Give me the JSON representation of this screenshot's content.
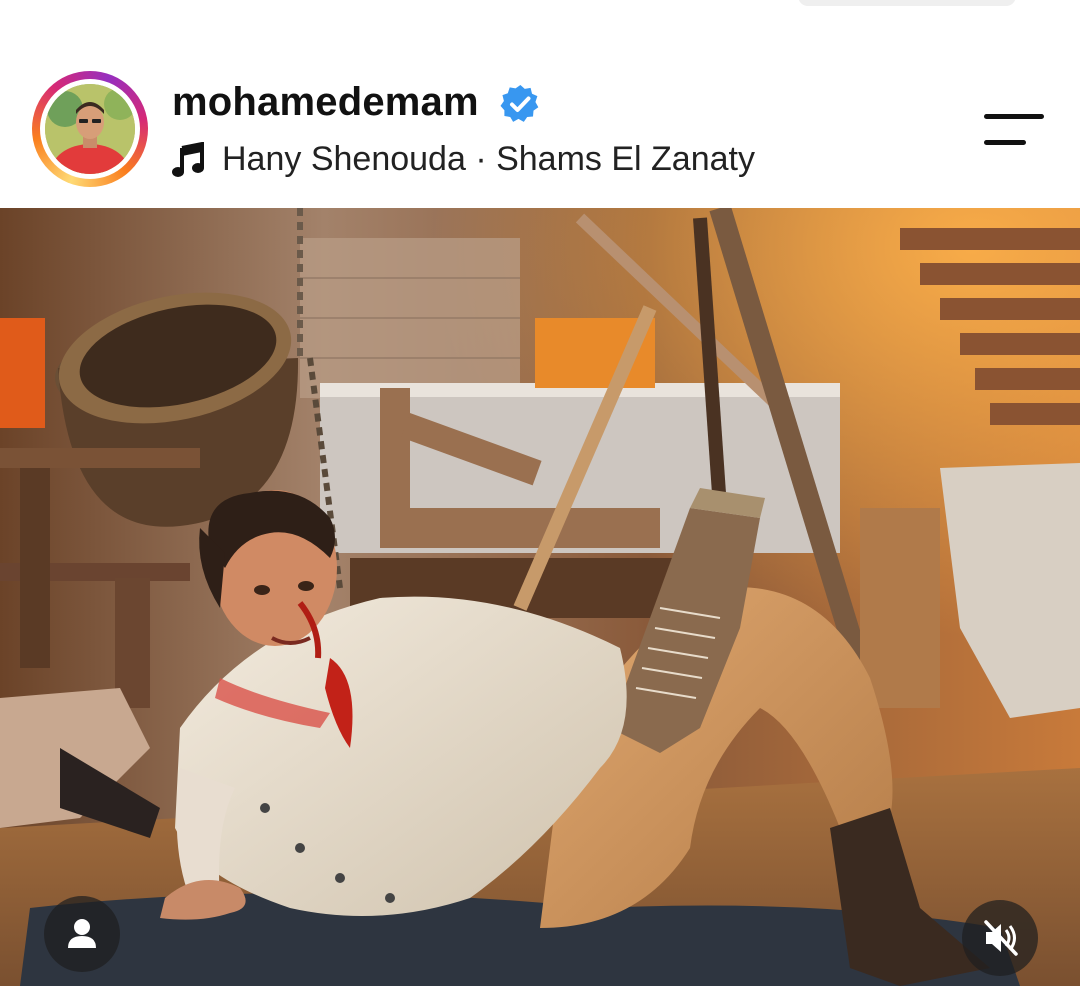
{
  "post_header": {
    "username": "mohamedemam",
    "verified": true,
    "music": {
      "artist": "Hany Shenouda",
      "separator": " · ",
      "track": "Shams El Zanaty"
    }
  },
  "icons": {
    "verified": "verified-badge-icon",
    "music": "music-note-icon",
    "menu": "menu-icon",
    "tagged_user": "tagged-user-icon",
    "mute": "speaker-muted-icon"
  },
  "media": {
    "type": "video",
    "muted": true
  },
  "colors": {
    "verified_blue": "#3897f0",
    "story_ring": [
      "#feda75",
      "#fa7e1e",
      "#d62976",
      "#962fbf"
    ]
  }
}
